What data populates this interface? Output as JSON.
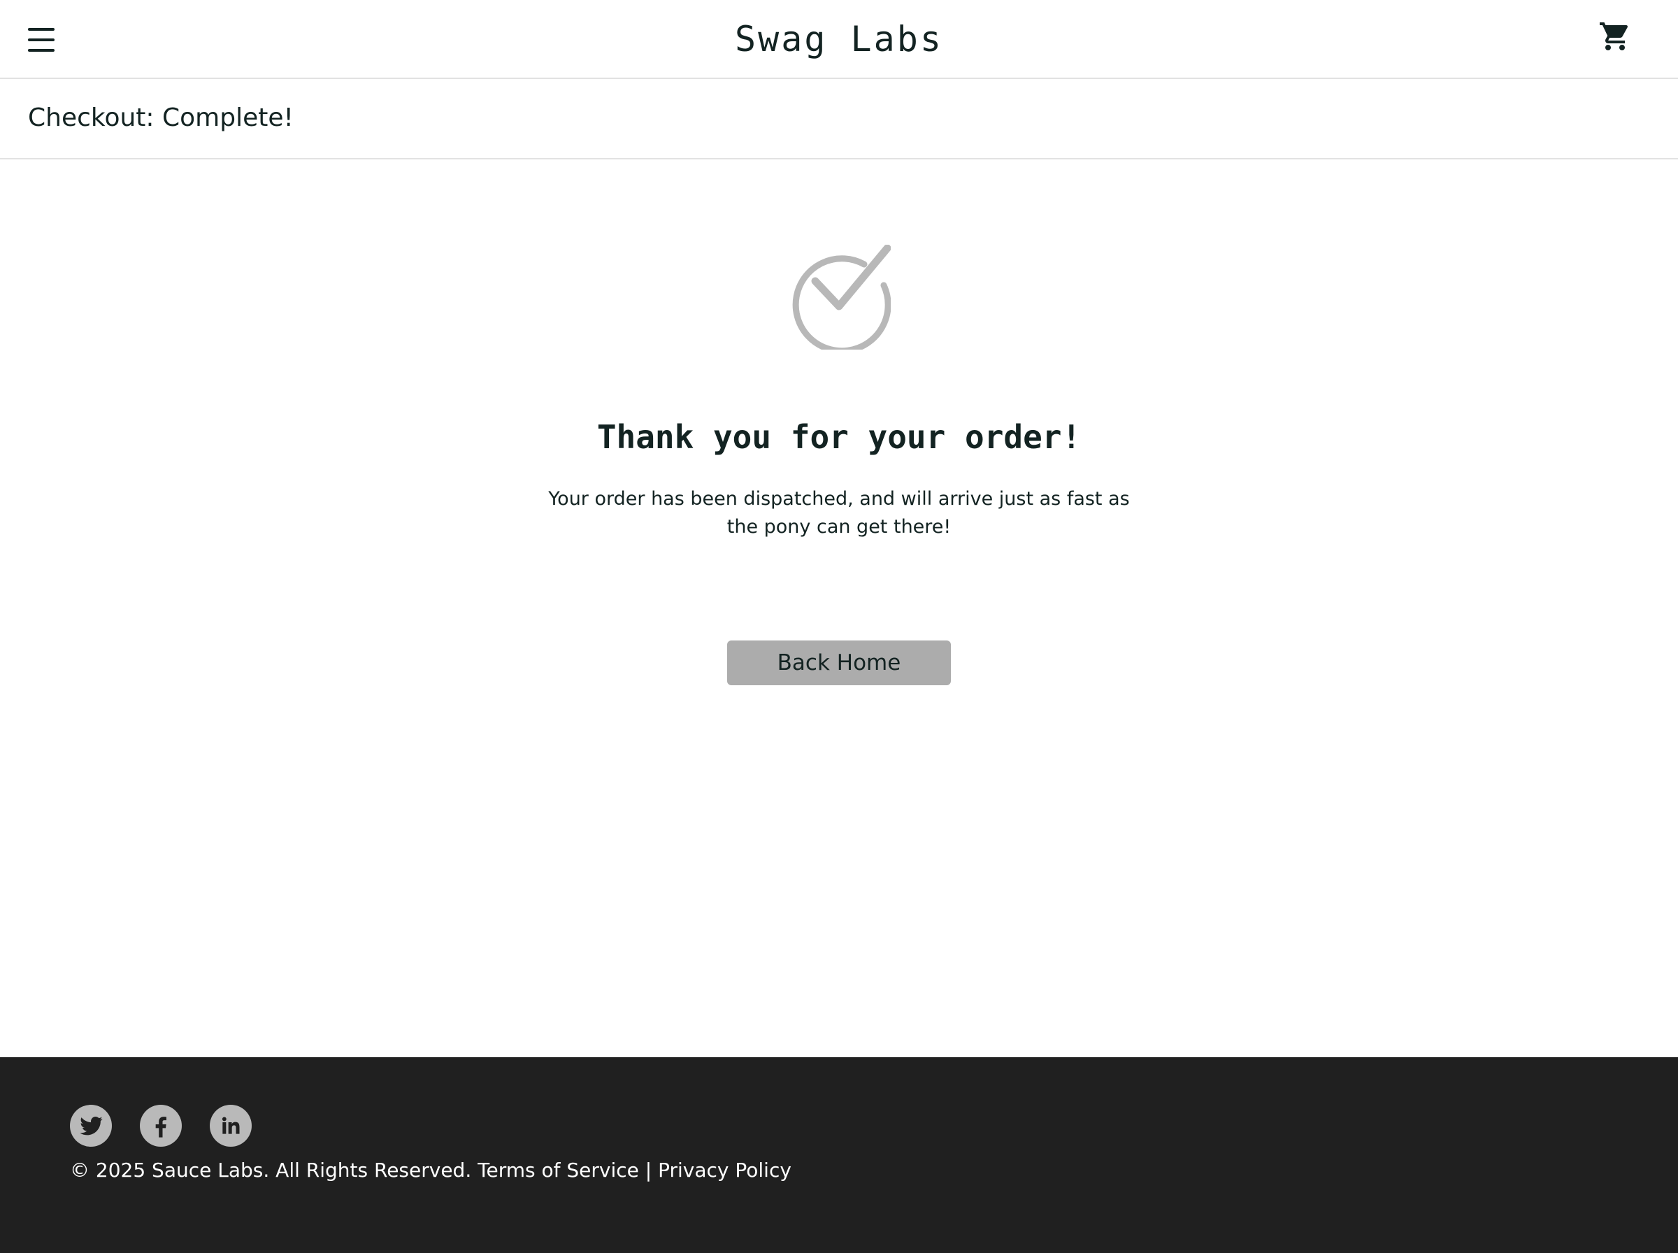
{
  "header": {
    "app_logo": "Swag Labs",
    "menu_icon": "hamburger-menu-icon",
    "cart_icon": "shopping-cart-icon"
  },
  "secondary_header": {
    "title": "Checkout: Complete!"
  },
  "complete": {
    "icon": "checkmark-circle-icon",
    "header": "Thank you for your order!",
    "text": "Your order has been dispatched, and will arrive just as fast as the pony can get there!",
    "back_button_label": "Back Home"
  },
  "footer": {
    "social": [
      "twitter-icon",
      "facebook-icon",
      "linkedin-icon"
    ],
    "copy": "© 2025 Sauce Labs. All Rights Reserved. Terms of Service | Privacy Policy"
  },
  "colors": {
    "text": "#132322",
    "border": "#e2e2e2",
    "button_bg": "#acacac",
    "icon_gray": "#b8b8b8",
    "footer_bg": "#202020",
    "footer_text": "#ffffff",
    "social_bg": "#b9b9b9"
  }
}
